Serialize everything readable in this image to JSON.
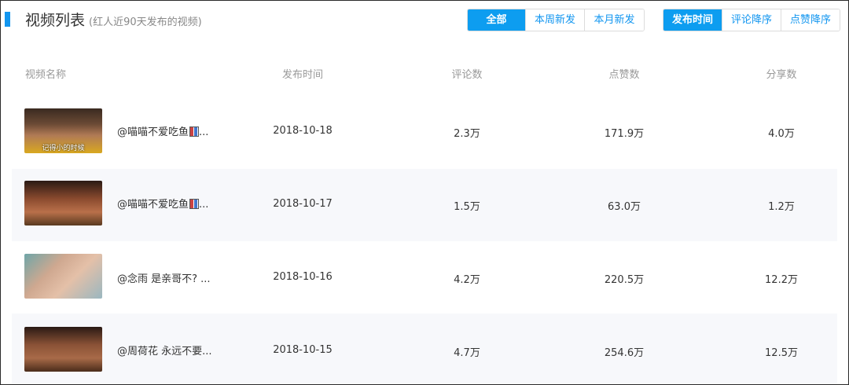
{
  "header": {
    "title": "视频列表",
    "subtitle": "(红人近90天发布的视频)",
    "filter_buttons": [
      {
        "label": "全部",
        "active": true
      },
      {
        "label": "本周新发",
        "active": false
      },
      {
        "label": "本月新发",
        "active": false
      }
    ],
    "sort_buttons": [
      {
        "label": "发布时间",
        "active": true
      },
      {
        "label": "评论降序",
        "active": false
      },
      {
        "label": "点赞降序",
        "active": false
      }
    ]
  },
  "table": {
    "columns": [
      "视频名称",
      "发布时间",
      "评论数",
      "点赞数",
      "分享数"
    ],
    "rows": [
      {
        "name": "@喵喵不爱吃鱼",
        "has_emoji": true,
        "suffix": "...",
        "thumb_caption": "记得小的时候",
        "date": "2018-10-18",
        "comments": "2.3万",
        "likes": "171.9万",
        "shares": "4.0万"
      },
      {
        "name": "@喵喵不爱吃鱼",
        "has_emoji": true,
        "suffix": "...",
        "thumb_caption": "",
        "date": "2018-10-17",
        "comments": "1.5万",
        "likes": "63.0万",
        "shares": "1.2万"
      },
      {
        "name": "@念雨 是亲哥不? ",
        "has_emoji": false,
        "suffix": "...",
        "thumb_caption": "",
        "date": "2018-10-16",
        "comments": "4.2万",
        "likes": "220.5万",
        "shares": "12.2万"
      },
      {
        "name": "@周荷花 永远不要",
        "has_emoji": false,
        "suffix": "...",
        "thumb_caption": "",
        "date": "2018-10-15",
        "comments": "4.7万",
        "likes": "254.6万",
        "shares": "12.5万"
      }
    ]
  },
  "colors": {
    "accent": "#0d9df0",
    "row_alt_bg": "#f7f8fb"
  }
}
